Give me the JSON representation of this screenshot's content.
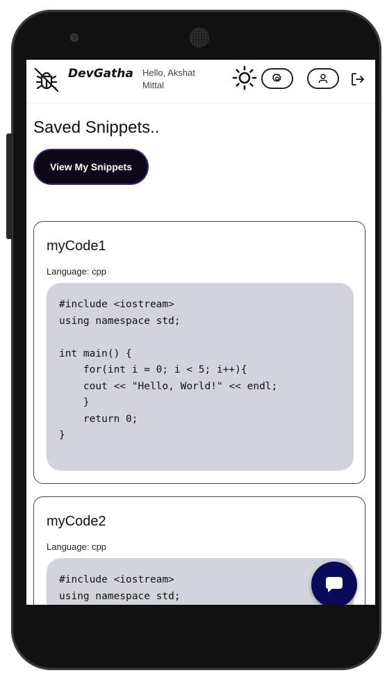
{
  "header": {
    "brand": "DevGatha",
    "greeting": "Hello, Akshat Mittal"
  },
  "page": {
    "title": "Saved Snippets..",
    "view_button": "View My Snippets"
  },
  "snippets": [
    {
      "title": "myCode1",
      "language_label": "Language: cpp",
      "code": "#include <iostream>\nusing namespace std;\n\nint main() {\n    for(int i = 0; i < 5; i++){\n    cout << \"Hello, World!\" << endl;\n    }\n    return 0;\n}"
    },
    {
      "title": "myCode2",
      "language_label": "Language: cpp",
      "code": "#include <iostream>\nusing namespace std;"
    }
  ],
  "icons": {
    "logo": "bug-off-icon",
    "theme": "sun-icon",
    "settings": "gear-icon",
    "profile": "user-icon",
    "logout": "logout-icon",
    "chat": "chat-icon"
  },
  "colors": {
    "primary_button": "#0d0718",
    "code_background": "#d1d5db",
    "fab": "#0a0a5a"
  }
}
